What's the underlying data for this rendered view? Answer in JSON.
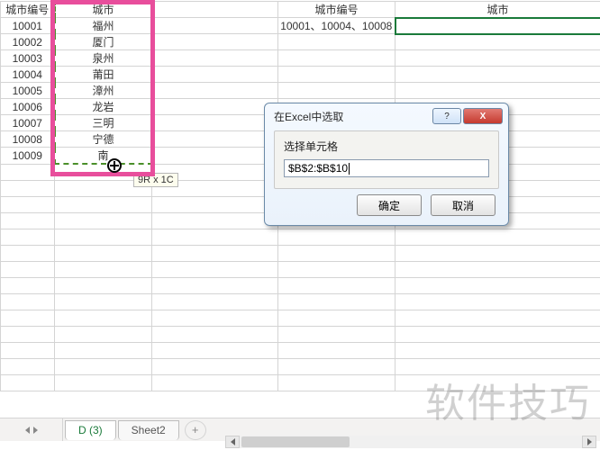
{
  "columns": {
    "a_header": "城市编号",
    "b_header": "城市",
    "d_header": "城市编号",
    "e_header": "城市"
  },
  "rows": [
    {
      "id": "10001",
      "city": "福州"
    },
    {
      "id": "10002",
      "city": "厦门"
    },
    {
      "id": "10003",
      "city": "泉州"
    },
    {
      "id": "10004",
      "city": "莆田"
    },
    {
      "id": "10005",
      "city": "漳州"
    },
    {
      "id": "10006",
      "city": "龙岩"
    },
    {
      "id": "10007",
      "city": "三明"
    },
    {
      "id": "10008",
      "city": "宁德"
    },
    {
      "id": "10009",
      "city": "南"
    }
  ],
  "d2_value": "10001、10004、10008",
  "selection_tip": "9R x 1C",
  "dialog": {
    "title": "在Excel中选取",
    "label": "选择单元格",
    "input_value": "$B$2:$B$10",
    "ok": "确定",
    "cancel": "取消",
    "help_tip": "?",
    "close_tip": "X"
  },
  "tabs": {
    "tab1": "D (3)",
    "tab2": "Sheet2",
    "add": "+"
  },
  "watermark": "软件技巧"
}
